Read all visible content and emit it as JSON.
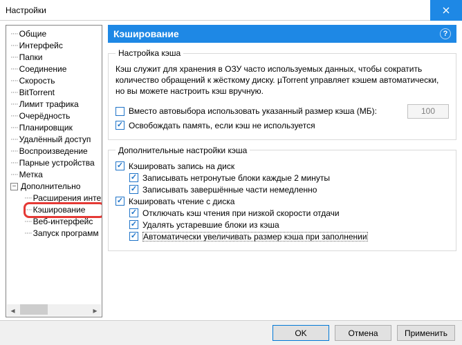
{
  "window": {
    "title": "Настройки"
  },
  "sidebar": {
    "items": [
      "Общие",
      "Интерфейс",
      "Папки",
      "Соединение",
      "Скорость",
      "BitTorrent",
      "Лимит трафика",
      "Очерёдность",
      "Планировщик",
      "Удалённый доступ",
      "Воспроизведение",
      "Парные устройства",
      "Метка"
    ],
    "advanced_label": "Дополнительно",
    "advanced_children": [
      "Расширения интерфейса",
      "Кэширование",
      "Веб-интерфейс",
      "Запуск программ"
    ],
    "selected_child_index": 1
  },
  "panel": {
    "title": "Кэширование",
    "group1": {
      "legend": "Настройка кэша",
      "description": "Кэш служит для хранения в ОЗУ часто используемых данных, чтобы сократить количество обращений к жёсткому диску. µTorrent управляет кэшем автоматически, но вы можете настроить кэш вручную.",
      "override_label": "Вместо автовыбора использовать указанный размер кэша (МБ):",
      "override_value": "100",
      "override_checked": false,
      "reduce_label": "Освобождать память, если кэш не используется",
      "reduce_checked": true
    },
    "group2": {
      "legend": "Дополнительные настройки кэша",
      "cache_write_label": "Кэшировать запись на диск",
      "cache_write_checked": true,
      "write_untouched_label": "Записывать нетронутые блоки каждые 2 минуты",
      "write_untouched_checked": true,
      "write_finished_label": "Записывать завершённые части немедленно",
      "write_finished_checked": true,
      "cache_read_label": "Кэшировать чтение с диска",
      "cache_read_checked": true,
      "disable_low_upload_label": "Отключать кэш чтения при низкой скорости отдачи",
      "disable_low_upload_checked": true,
      "remove_old_label": "Удалять устаревшие блоки из кэша",
      "remove_old_checked": true,
      "auto_increase_label": "Автоматически увеличивать размер кэша при заполнении",
      "auto_increase_checked": true
    }
  },
  "buttons": {
    "ok": "OK",
    "cancel": "Отмена",
    "apply": "Применить"
  }
}
